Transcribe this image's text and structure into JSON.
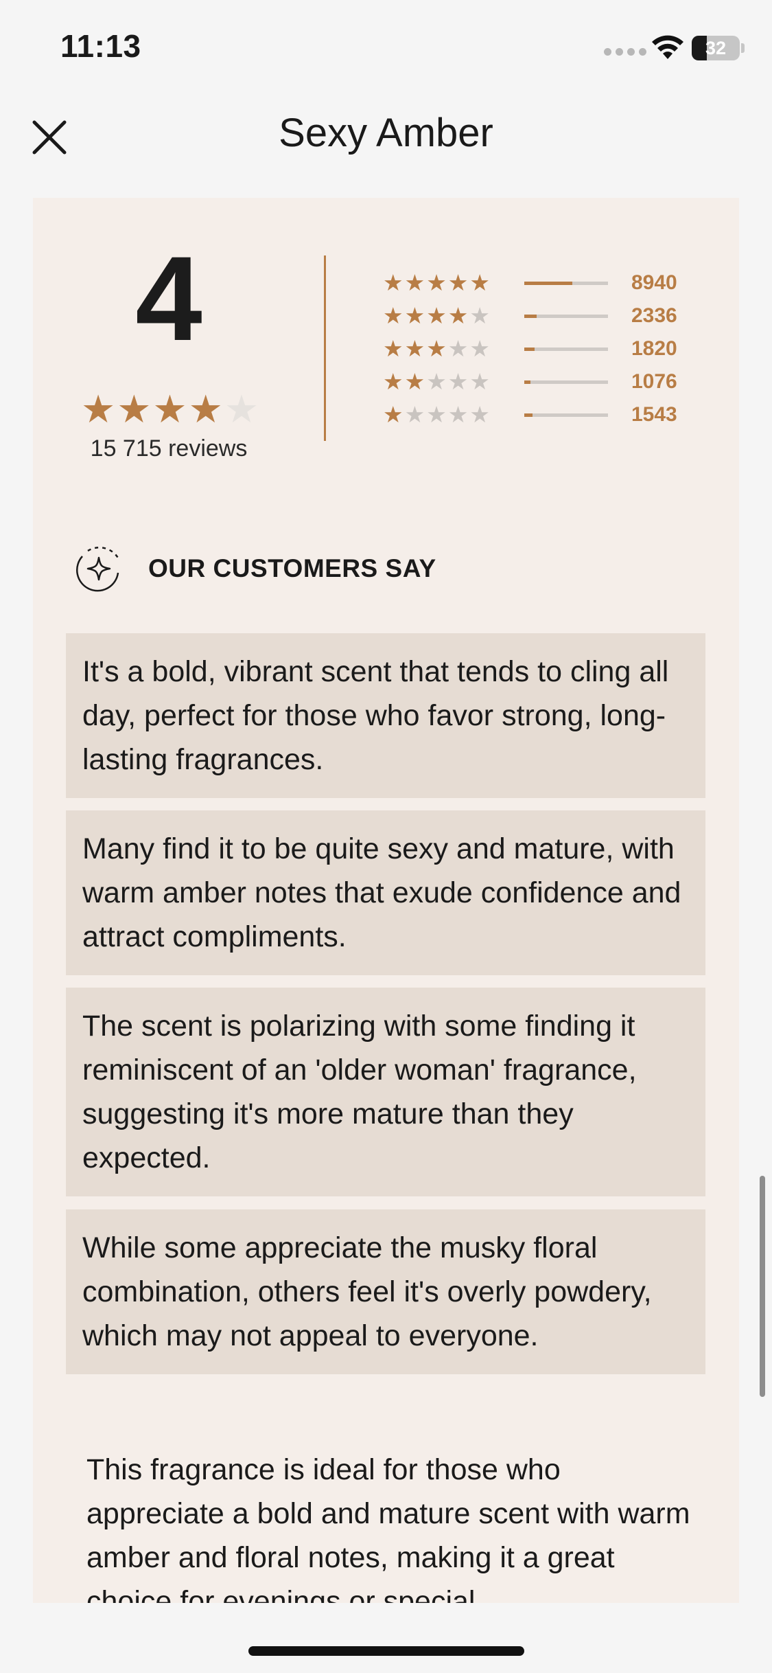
{
  "status_bar": {
    "time": "11:13",
    "battery": "32",
    "battery_level": 0.32
  },
  "header": {
    "title": "Sexy Amber",
    "close_icon": "close-icon"
  },
  "rating": {
    "score": "4",
    "stars": 4,
    "max_stars": 5,
    "review_count": "15 715 reviews",
    "distribution": [
      {
        "stars": 5,
        "count": "8940",
        "fraction": 0.57
      },
      {
        "stars": 4,
        "count": "2336",
        "fraction": 0.15
      },
      {
        "stars": 3,
        "count": "1820",
        "fraction": 0.12
      },
      {
        "stars": 2,
        "count": "1076",
        "fraction": 0.07
      },
      {
        "stars": 1,
        "count": "1543",
        "fraction": 0.1
      }
    ]
  },
  "customers_say": {
    "title": "OUR CUSTOMERS SAY",
    "icon": "sparkle-icon",
    "quotes": [
      "It's a bold, vibrant scent that tends to cling all day, perfect for those who favor strong, long-lasting fragrances.",
      "Many find it to be quite sexy and mature, with warm amber notes that exude confidence and attract compliments.",
      "The scent is polarizing with some finding it reminiscent of an 'older woman' fragrance, suggesting it's more mature than they expected.",
      "While some appreciate the musky floral combination, others feel it's overly powdery, which may not appeal to everyone."
    ],
    "summary": "This fragrance is ideal for those who appreciate a bold and mature scent with warm amber and floral notes, making it a great choice for evenings or special"
  },
  "colors": {
    "accent": "#b87d45",
    "card_bg": "#f5eee9",
    "quote_bg": "#e6dcd3",
    "page_bg": "#f5f5f5"
  }
}
